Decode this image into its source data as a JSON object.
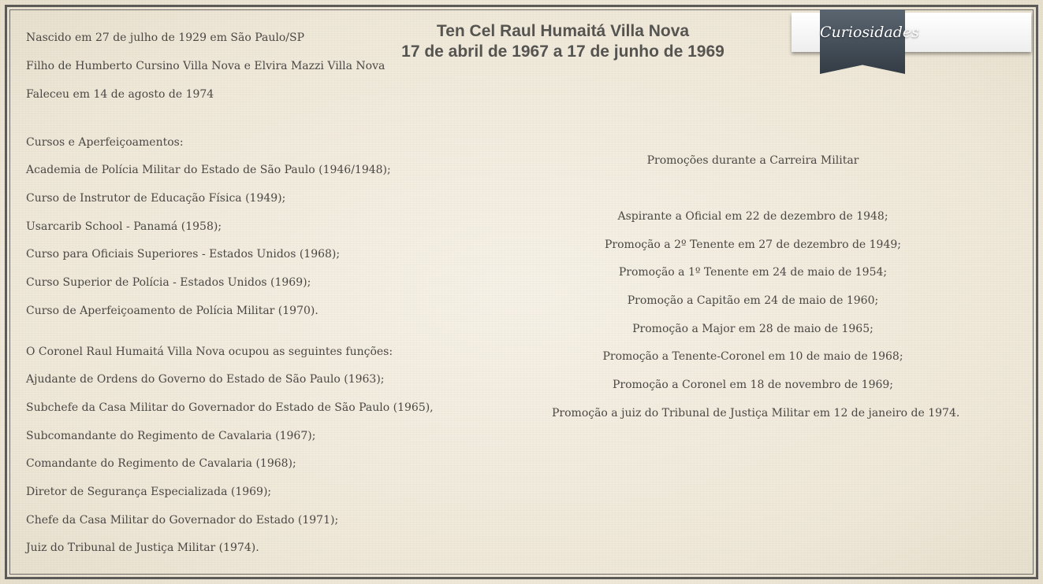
{
  "header": {
    "name": "Ten Cel Raul Humaitá Villa Nova",
    "period": "17 de abril de 1967 a 17 de junho de 1969"
  },
  "ribbon": {
    "label": "Curiosidades"
  },
  "bio": [
    "Nascido em 27 de julho de 1929 em São Paulo/SP",
    "Filho de Humberto Cursino Villa Nova e Elvira Mazzi Villa Nova",
    "Faleceu em 14 de agosto de 1974"
  ],
  "courses": {
    "heading": "Cursos e Aperfeiçoamentos:",
    "items": [
      "Academia de Polícia Militar do Estado de São Paulo (1946/1948);",
      "Curso de Instrutor de Educação Física (1949);",
      "Usarcarib School - Panamá (1958);",
      "Curso para Oficiais Superiores - Estados Unidos (1968);",
      "Curso Superior de Polícia - Estados Unidos (1969);",
      "Curso de Aperfeiçoamento de Polícia Militar (1970)."
    ]
  },
  "functions": {
    "heading": "O Coronel Raul Humaitá Villa Nova ocupou as seguintes funções:",
    "items": [
      "Ajudante de Ordens do Governo do Estado de São Paulo (1963);",
      "Subchefe da Casa Militar do Governador do Estado de São Paulo (1965),",
      "Subcomandante do Regimento de Cavalaria (1967);",
      "Comandante do Regimento de Cavalaria (1968);",
      "Diretor de Segurança Especializada (1969);",
      "Chefe da Casa Militar do Governador do Estado (1971);",
      "Juiz do Tribunal de Justiça Militar (1974)."
    ]
  },
  "promotions": {
    "heading": "Promoções durante a Carreira Militar",
    "items": [
      "Aspirante a Oficial em 22 de dezembro de 1948;",
      "Promoção a 2º Tenente em 27 de dezembro de 1949;",
      "Promoção a 1º Tenente em 24 de maio de 1954;",
      "Promoção a Capitão em 24 de maio de 1960;",
      "Promoção a Major em 28 de maio de 1965;",
      "Promoção a Tenente-Coronel em 10 de maio de 1968;",
      "Promoção a Coronel em 18 de novembro de 1969;",
      "Promoção a juiz do Tribunal de Justiça Militar em 12 de janeiro de 1974."
    ]
  }
}
